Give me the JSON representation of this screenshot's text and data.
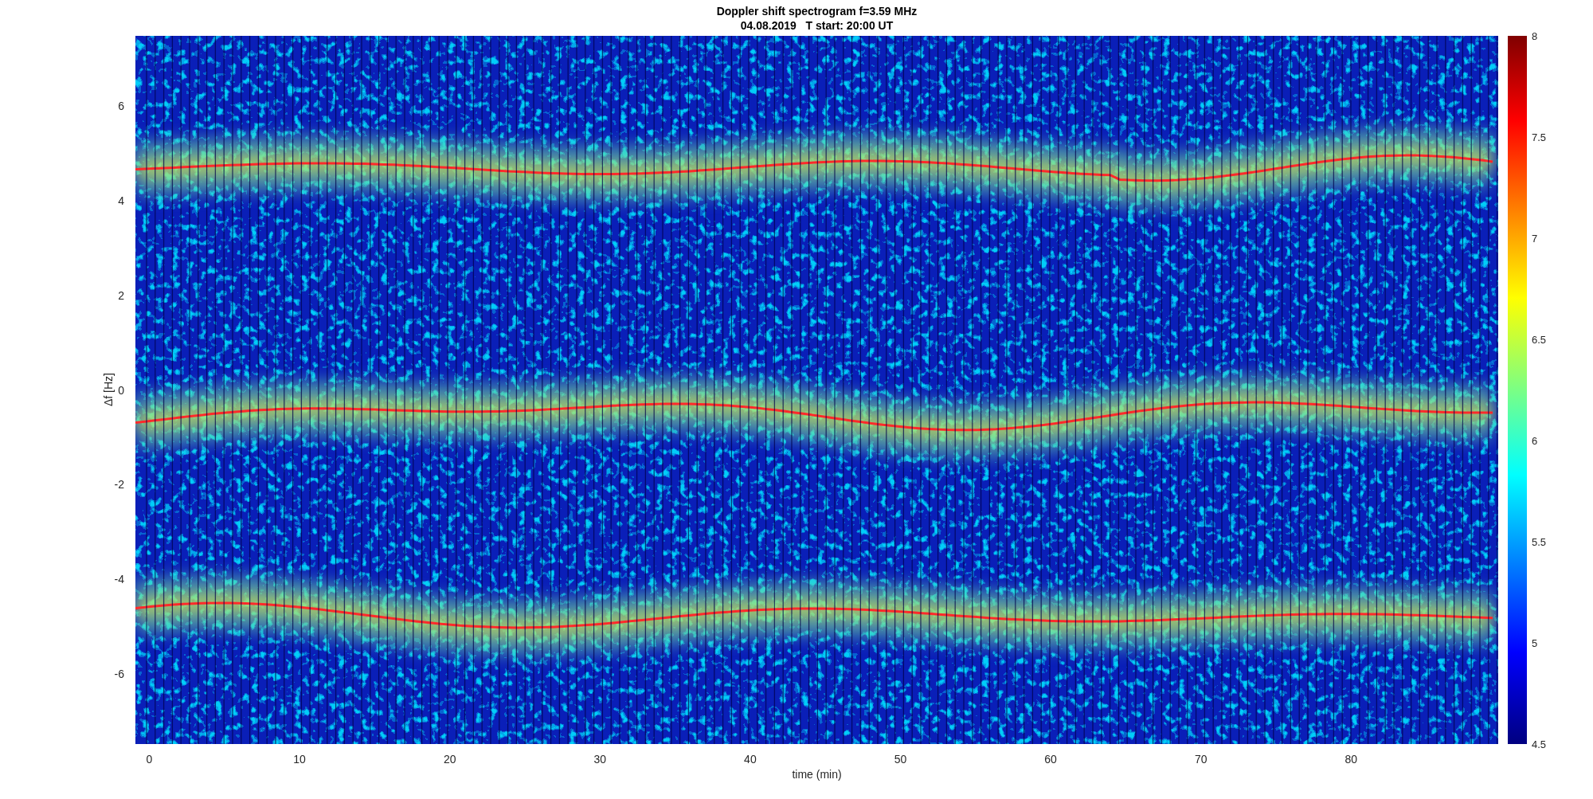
{
  "title_lines": [
    "Doppler shift spectrogram f=3.59 MHz",
    "04.08.2019   T start: 20:00 UT"
  ],
  "axes": {
    "xlabel": "time (min)",
    "ylabel": "Δf [Hz]",
    "xticks": [
      "0",
      "10",
      "20",
      "30",
      "40",
      "50",
      "60",
      "70",
      "80"
    ],
    "yticks": [
      "6",
      "4",
      "2",
      "0",
      "-2",
      "-4",
      "-6"
    ]
  },
  "colorbar": {
    "ticks": [
      "8",
      "7.5",
      "7",
      "6.5",
      "6",
      "5.5",
      "5",
      "4.5"
    ]
  }
}
